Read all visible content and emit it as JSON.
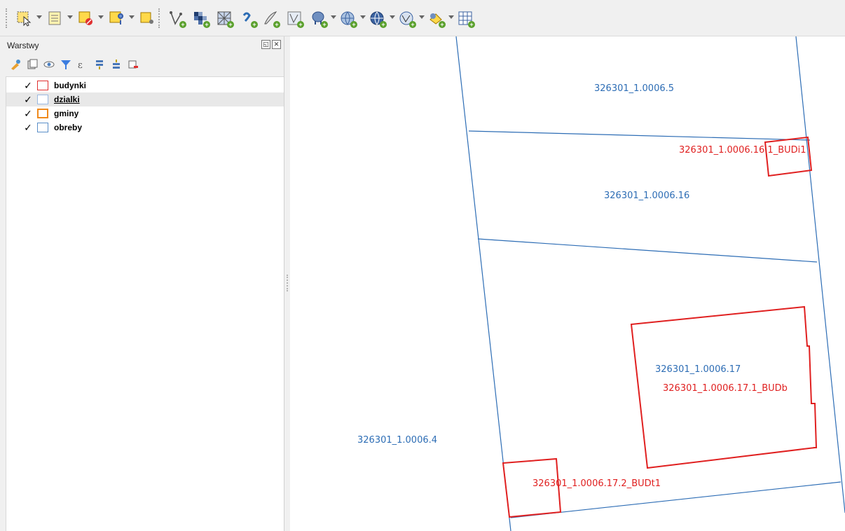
{
  "toolbar": {
    "icons": [
      "select-features-icon",
      "open-attribute-table-icon",
      "deselect-features-icon",
      "select-by-location-icon",
      "add-vector-layer-icon",
      "add-raster-layer-icon",
      "add-mesh-layer-icon",
      "add-gps-layer-icon",
      "add-delimited-text-layer-icon",
      "add-spatialite-layer-icon",
      "add-postgis-layer-icon",
      "add-wms-layer-icon",
      "add-wcs-layer-icon",
      "add-wfs-layer-icon",
      "add-virtual-layer-icon",
      "new-temporary-layer-icon"
    ]
  },
  "panel": {
    "title": "Warstwy",
    "layers": [
      {
        "name": "budynki",
        "checked": "✓",
        "color": "#e03030"
      },
      {
        "name": "dzialki",
        "checked": "✓",
        "color": "#9ab8e0"
      },
      {
        "name": "gminy",
        "checked": "✓",
        "color": "#f08a1c"
      },
      {
        "name": "obreby",
        "checked": "✓",
        "color": "#5a8ec8"
      }
    ]
  },
  "map": {
    "parcel_color": "#2d6db5",
    "building_color": "#e02020",
    "labels": {
      "p65": "326301_1.0006.5",
      "p616": "326301_1.0006.16",
      "b6161": "326301_1.0006.16.1_BUDi1",
      "p617": "326301_1.0006.17",
      "b6171": "326301_1.0006.17.1_BUDb",
      "p64": "326301_1.0006.4",
      "b6172": "326301_1.0006.17.2_BUDt1"
    }
  }
}
